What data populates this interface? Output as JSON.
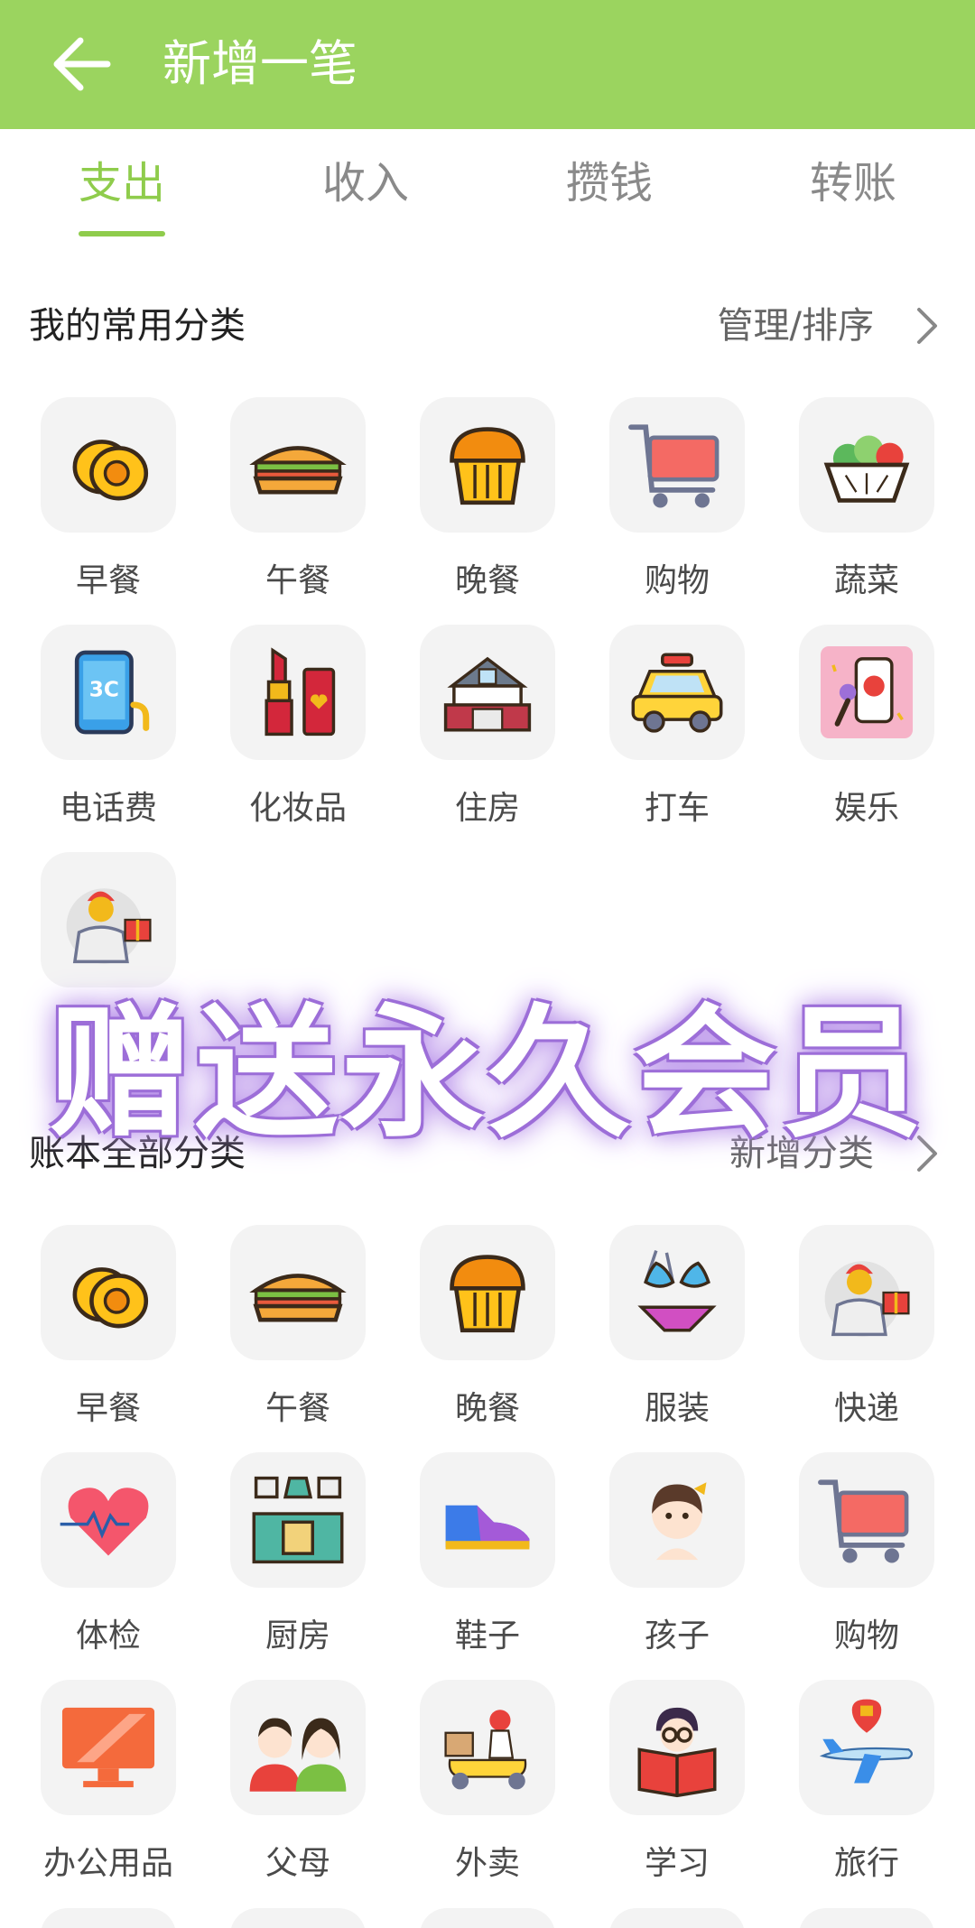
{
  "appbar": {
    "title": "新增一笔",
    "back_icon": "arrow-left-icon",
    "color": "#9bd45f"
  },
  "tabs": [
    {
      "label": "支出",
      "active": true
    },
    {
      "label": "收入",
      "active": false
    },
    {
      "label": "攒钱",
      "active": false
    },
    {
      "label": "转账",
      "active": false
    }
  ],
  "accent": "#8fcc4c",
  "favorites": {
    "title": "我的常用分类",
    "action": "管理/排序",
    "items": [
      {
        "label": "早餐",
        "icon": "fried-egg-icon"
      },
      {
        "label": "午餐",
        "icon": "sandwich-icon"
      },
      {
        "label": "晚餐",
        "icon": "muffin-icon"
      },
      {
        "label": "购物",
        "icon": "shopping-cart-icon"
      },
      {
        "label": "蔬菜",
        "icon": "salad-icon"
      },
      {
        "label": "电话费",
        "icon": "phone-3c-icon"
      },
      {
        "label": "化妆品",
        "icon": "lipstick-icon"
      },
      {
        "label": "住房",
        "icon": "house-icon"
      },
      {
        "label": "打车",
        "icon": "taxi-icon"
      },
      {
        "label": "娱乐",
        "icon": "music-phone-icon"
      },
      {
        "label": "",
        "icon": "courier-icon"
      }
    ]
  },
  "all_categories": {
    "title": "账本全部分类",
    "action": "新增分类",
    "items": [
      {
        "label": "早餐",
        "icon": "fried-egg-icon"
      },
      {
        "label": "午餐",
        "icon": "sandwich-icon"
      },
      {
        "label": "晚餐",
        "icon": "muffin-icon"
      },
      {
        "label": "服装",
        "icon": "bikini-icon"
      },
      {
        "label": "快递",
        "icon": "courier-icon"
      },
      {
        "label": "体检",
        "icon": "heartbeat-icon"
      },
      {
        "label": "厨房",
        "icon": "kitchen-icon"
      },
      {
        "label": "鞋子",
        "icon": "sneaker-icon"
      },
      {
        "label": "孩子",
        "icon": "child-icon"
      },
      {
        "label": "购物",
        "icon": "shopping-cart-icon"
      },
      {
        "label": "办公用品",
        "icon": "monitor-icon"
      },
      {
        "label": "父母",
        "icon": "parents-icon"
      },
      {
        "label": "外卖",
        "icon": "delivery-scooter-icon"
      },
      {
        "label": "学习",
        "icon": "reading-icon"
      },
      {
        "label": "旅行",
        "icon": "airplane-icon"
      }
    ]
  },
  "promo_overlay": "赠送永久会员"
}
